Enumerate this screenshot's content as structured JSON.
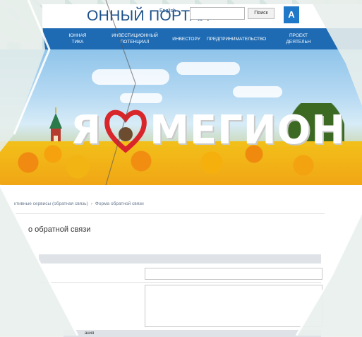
{
  "header": {
    "portal_title": "ОННЫЙ ПОРТАЛ",
    "lang_label": "English",
    "search_placeholder": "",
    "search_button": "Поиск",
    "accessibility_button": "A"
  },
  "nav": {
    "items": [
      {
        "label": "ЮННАЯ\nТИКА"
      },
      {
        "label": "ИНВЕСТИЦИОННЫЙ\nПОТЕНЦИАЛ"
      },
      {
        "label": "ИНВЕСТОРУ"
      },
      {
        "label": "ПРЕДПРИНИМАТЕЛЬСТВО"
      },
      {
        "label": "ПРОЕКТ\nДЕЯТЕЛЬН"
      }
    ]
  },
  "banner": {
    "sign_left": "Я",
    "sign_right": "МЕГИОН",
    "colors": {
      "heart": "#d9262b",
      "sky": "#8fc4ea",
      "flowers": "#f3a210"
    }
  },
  "breadcrumb": {
    "parent": "ктивные сервисы (обратная связь)",
    "current": "Форма обратной связи"
  },
  "page_heading": "о обратной связи",
  "form": {
    "bottom_label": "ания"
  },
  "colors": {
    "accent": "#1e6bb4",
    "title": "#1a4f8a"
  }
}
